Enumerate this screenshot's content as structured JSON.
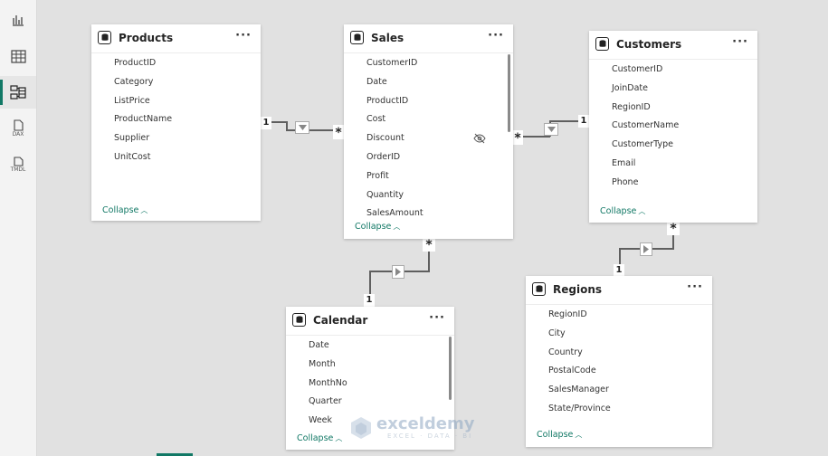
{
  "rail": {
    "items": [
      {
        "icon": "report-view-icon"
      },
      {
        "icon": "table-view-icon"
      },
      {
        "icon": "model-view-icon",
        "active": true
      },
      {
        "icon": "dax-query-view-icon",
        "label": "DAX"
      },
      {
        "icon": "tmdl-view-icon",
        "label": "TMDL"
      }
    ]
  },
  "tables": {
    "products": {
      "title": "Products",
      "more": "···",
      "fields": [
        "ProductID",
        "Category",
        "ListPrice",
        "ProductName",
        "Supplier",
        "UnitCost"
      ],
      "collapse": "Collapse"
    },
    "sales": {
      "title": "Sales",
      "more": "···",
      "fields": [
        "CustomerID",
        "Date",
        "ProductID",
        "Cost",
        "Discount",
        "OrderID",
        "Profit",
        "Quantity",
        "SalesAmount"
      ],
      "hidden_field": "Discount",
      "collapse": "Collapse"
    },
    "customers": {
      "title": "Customers",
      "more": "···",
      "fields": [
        "CustomerID",
        "JoinDate",
        "RegionID",
        "CustomerName",
        "CustomerType",
        "Email",
        "Phone"
      ],
      "collapse": "Collapse"
    },
    "regions": {
      "title": "Regions",
      "more": "···",
      "fields": [
        "RegionID",
        "City",
        "Country",
        "PostalCode",
        "SalesManager",
        "State/Province"
      ],
      "collapse": "Collapse"
    },
    "calendar": {
      "title": "Calendar",
      "more": "···",
      "fields": [
        "Date",
        "Month",
        "MonthNo",
        "Quarter",
        "Week"
      ],
      "collapse": "Collapse"
    }
  },
  "relationships": {
    "products_sales": {
      "one": "1",
      "many": "*"
    },
    "sales_customers": {
      "one": "1",
      "many": "*"
    },
    "sales_calendar": {
      "one": "1",
      "many": "*"
    },
    "customers_regions": {
      "one": "1",
      "many": "*"
    }
  },
  "watermark": {
    "name": "exceldemy",
    "sub": "EXCEL · DATA · BI"
  },
  "colors": {
    "accent": "#117865",
    "canvas": "#e1e1e1",
    "line": "#5f5f5f"
  }
}
